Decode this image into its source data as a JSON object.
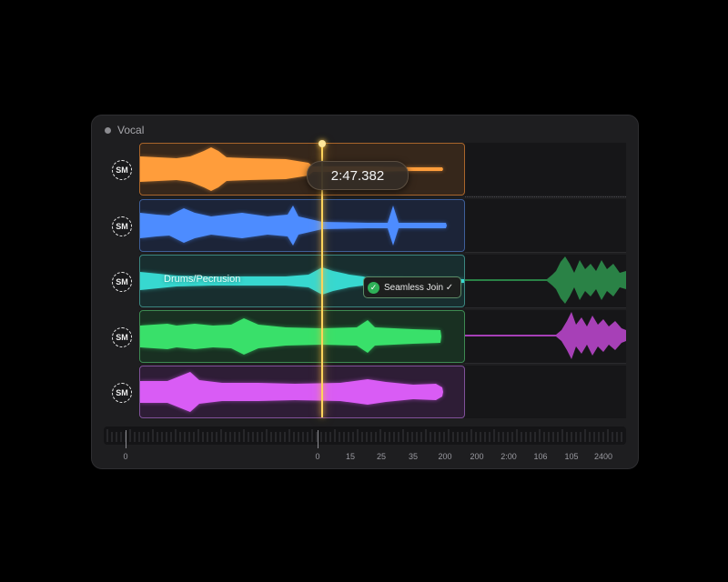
{
  "panel": {
    "title": "Vocal"
  },
  "tracks": [
    {
      "id": "orange",
      "badge": "SM",
      "color": "#ff9d3b",
      "bg": "rgba(255,150,50,0.14)",
      "border": "#a9652b",
      "label": ""
    },
    {
      "id": "blue",
      "badge": "SM",
      "color": "#4d8cff",
      "bg": "rgba(70,130,255,0.14)",
      "border": "#3e5f99",
      "label": ""
    },
    {
      "id": "teal",
      "badge": "SM",
      "color": "#37d8d0",
      "bg": "rgba(40,200,190,0.14)",
      "border": "#3b8680",
      "label": "Drums/Pecrusion"
    },
    {
      "id": "green",
      "badge": "SM",
      "color": "#39e06a",
      "bg": "rgba(50,210,100,0.14)",
      "border": "#3d8a52",
      "label": ""
    },
    {
      "id": "purple",
      "badge": "SM",
      "color": "#d95cf5",
      "bg": "rgba(200,80,240,0.14)",
      "border": "#80519a",
      "label": ""
    }
  ],
  "playhead": {
    "time": "2:47.382"
  },
  "seamless_join": {
    "label": "Seamless Join ✓"
  },
  "ruler": {
    "labels": [
      "0",
      "0",
      "15",
      "25",
      "35",
      "200",
      "200",
      "2:00",
      "106",
      "105",
      "2400"
    ]
  }
}
